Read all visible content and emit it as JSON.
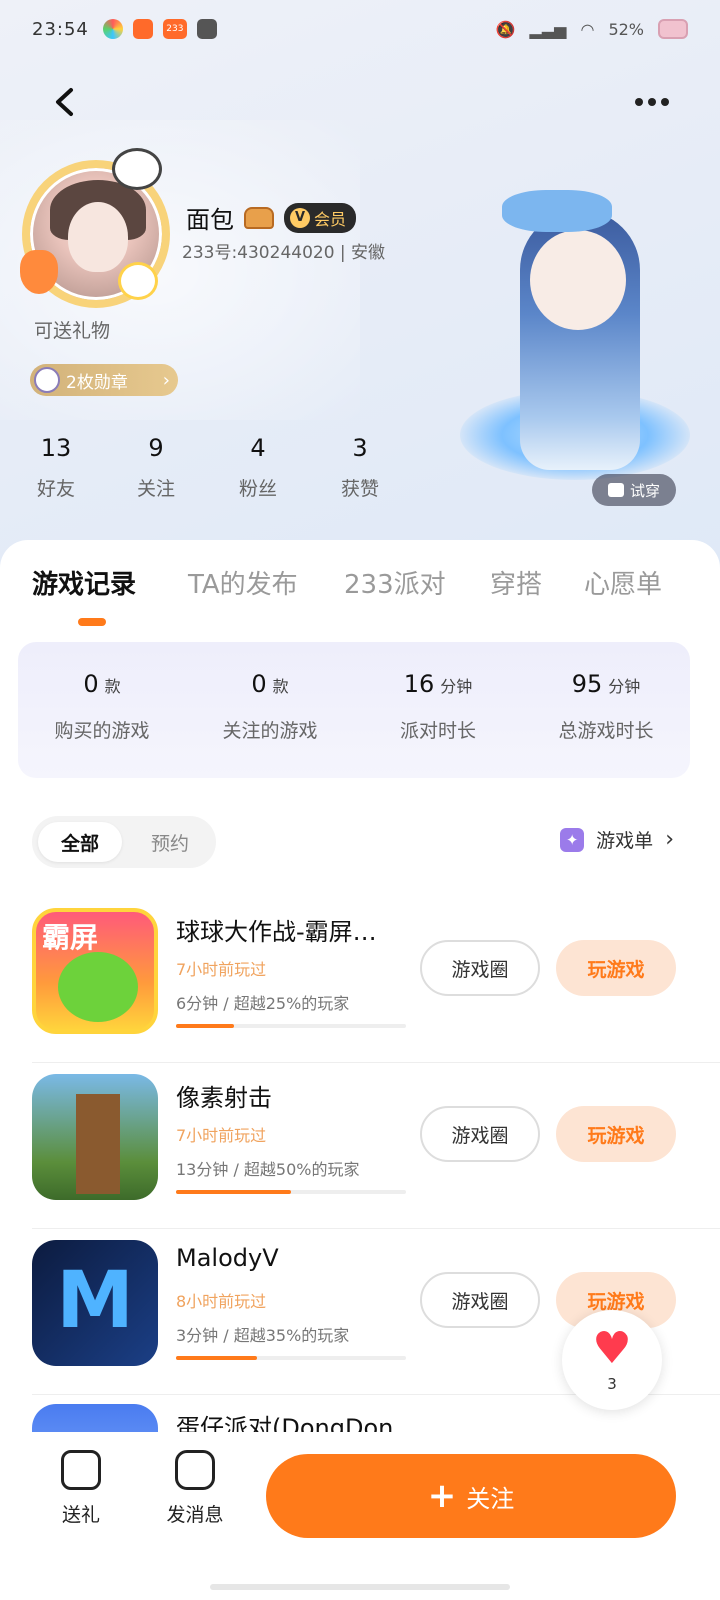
{
  "status_bar": {
    "time": "23:54",
    "app_icon_label": "233",
    "battery": "52%",
    "colors": {
      "battery": "#f1c2cf"
    }
  },
  "profile": {
    "username": "面包",
    "vip_label": "会员",
    "uid_text": "233号:430244020 | 安徽",
    "gift_note": "可送礼物",
    "medal_text": "2枚勋章",
    "stats": [
      {
        "num": "13",
        "label": "好友"
      },
      {
        "num": "9",
        "label": "关注"
      },
      {
        "num": "4",
        "label": "粉丝"
      },
      {
        "num": "3",
        "label": "获赞"
      }
    ],
    "try_on": "试穿"
  },
  "tabs": [
    "游戏记录",
    "TA的发布",
    "233派对",
    "穿搭",
    "心愿单"
  ],
  "summary": [
    {
      "value": "0",
      "unit": "款",
      "label": "购买的游戏"
    },
    {
      "value": "0",
      "unit": "款",
      "label": "关注的游戏"
    },
    {
      "value": "16",
      "unit": "分钟",
      "label": "派对时长"
    },
    {
      "value": "95",
      "unit": "分钟",
      "label": "总游戏时长"
    }
  ],
  "filter": {
    "all": "全部",
    "reserve": "预约",
    "gamelist": "游戏单"
  },
  "games": [
    {
      "name": "球球大作战-霸屏…",
      "played": "7小时前玩过",
      "duration": "6分钟 / 超越25%的玩家",
      "progress": 0.25,
      "circle": "游戏圈",
      "play": "玩游戏",
      "icon_text": "霸屏"
    },
    {
      "name": "像素射击",
      "played": "7小时前玩过",
      "duration": "13分钟 / 超越50%的玩家",
      "progress": 0.5,
      "circle": "游戏圈",
      "play": "玩游戏"
    },
    {
      "name": "MalodyV",
      "played": "8小时前玩过",
      "duration": "3分钟 / 超越35%的玩家",
      "progress": 0.35,
      "circle": "游戏圈",
      "play": "玩游戏",
      "icon_text": "M"
    },
    {
      "name": "蛋仔派对(DongDon…"
    }
  ],
  "like": {
    "count": "3"
  },
  "bottom": {
    "gift": "送礼",
    "message": "发消息",
    "follow": "关注"
  },
  "colors": {
    "accent": "#ff7a1a",
    "vip_gold": "#ffcb64",
    "played_text": "#f0a35e"
  }
}
